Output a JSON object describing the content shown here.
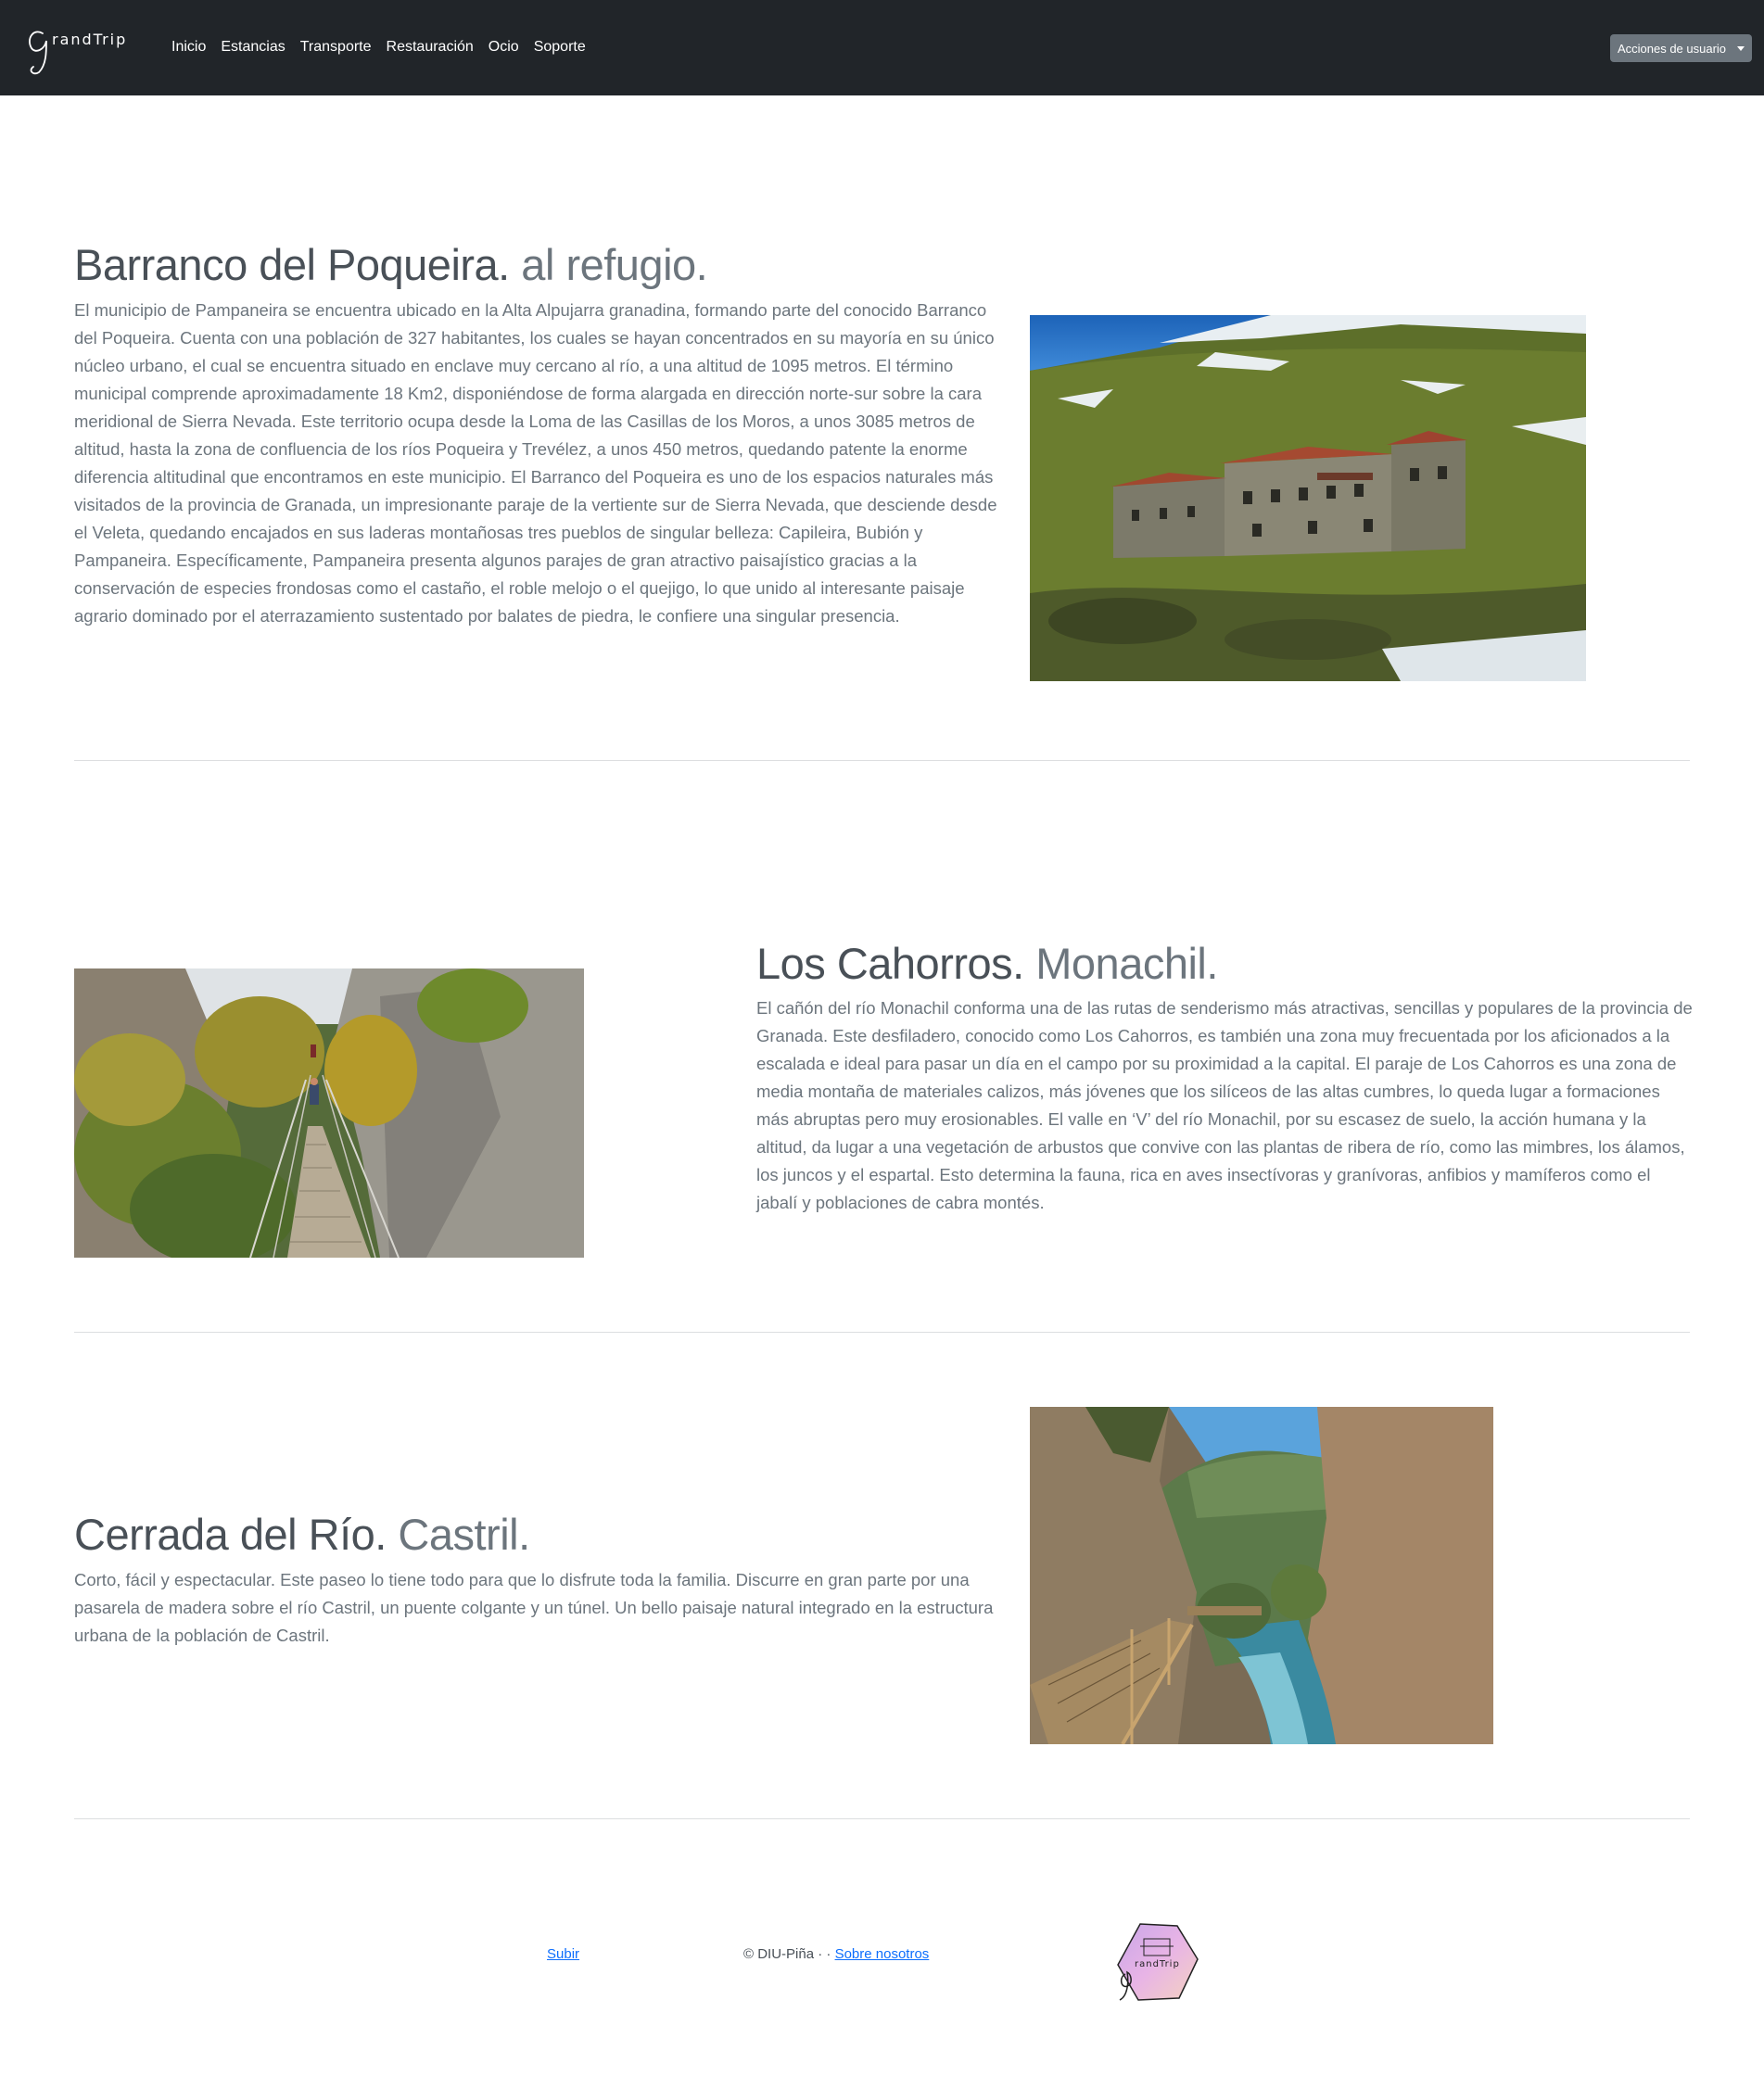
{
  "navbar": {
    "brand": "randTrip",
    "links": [
      "Inicio",
      "Estancias",
      "Transporte",
      "Restauración",
      "Ocio",
      "Soporte"
    ],
    "user_menu_label": "Acciones de usuario"
  },
  "sections": [
    {
      "title_main": "Barranco del Poqueira.",
      "title_muted": " al refugio.",
      "text": "El municipio de Pampaneira se encuentra ubicado en la Alta Alpujarra granadina, formando parte del conocido Barranco del Poqueira. Cuenta con una población de 327 habitantes, los cuales se hayan concentrados en su mayoría en su único núcleo urbano, el cual se encuentra situado en enclave muy cercano al río, a una altitud de 1095 metros. El término municipal comprende aproximadamente 18 Km2, disponiéndose de forma alargada en dirección norte-sur sobre la cara meridional de Sierra Nevada. Este territorio ocupa desde la Loma de las Casillas de los Moros, a unos 3085 metros de altitud, hasta la zona de confluencia de los ríos Poqueira y Trevélez, a unos 450 metros, quedando patente la enorme diferencia altitudinal que encontramos en este municipio. El Barranco del Poqueira es uno de los espacios naturales más visitados de la provincia de Granada, un impresionante paraje de la vertiente sur de Sierra Nevada, que desciende desde el Veleta, quedando encajados en sus laderas montañosas tres pueblos de singular belleza: Capileira, Bubión y Pampaneira. Específicamente, Pampaneira presenta algunos parajes de gran atractivo paisajístico gracias a la conservación de especies frondosas como el castaño, el roble melojo o el quejigo, lo que unido al interesante paisaje agrario dominado por el aterrazamiento sustentado por balates de piedra, le confiere una singular presencia."
    },
    {
      "title_main": "Los Cahorros.",
      "title_muted": " Monachil.",
      "text": "El cañón del río Monachil conforma una de las rutas de senderismo más atractivas, sencillas y populares de la provincia de Granada. Este desfiladero, conocido como Los Cahorros, es también una zona muy frecuentada por los aficionados a la escalada e ideal para pasar un día en el campo por su proximidad a la capital. El paraje de Los Cahorros es una zona de media montaña de materiales calizos, más jóvenes que los silíceos de las altas cumbres, lo queda lugar a formaciones más abruptas pero muy erosionables. El valle en ‘V’ del río Monachil, por su escasez de suelo, la acción humana y la altitud, da lugar a una vegetación de arbustos que convive con las plantas de ribera de río, como las mimbres, los álamos, los juncos y el espartal. Esto determina la fauna, rica en aves insectívoras y granívoras, anfibios y mamíferos como el jabalí y poblaciones de cabra montés."
    },
    {
      "title_main": "Cerrada del Río.",
      "title_muted": " Castril.",
      "text": "Corto, fácil y espectacular. Este paseo lo tiene todo para que lo disfrute toda la familia. Discurre en gran parte por una pasarela de madera sobre el río Castril, un puente colgante y un túnel. Un bello paisaje natural integrado en la estructura urbana de la población de Castril."
    }
  ],
  "footer": {
    "back_to_top": "Subir",
    "copyright": "© DIU-Piña · · ",
    "about": "Sobre nosotros",
    "logo_text": "randTrip"
  }
}
